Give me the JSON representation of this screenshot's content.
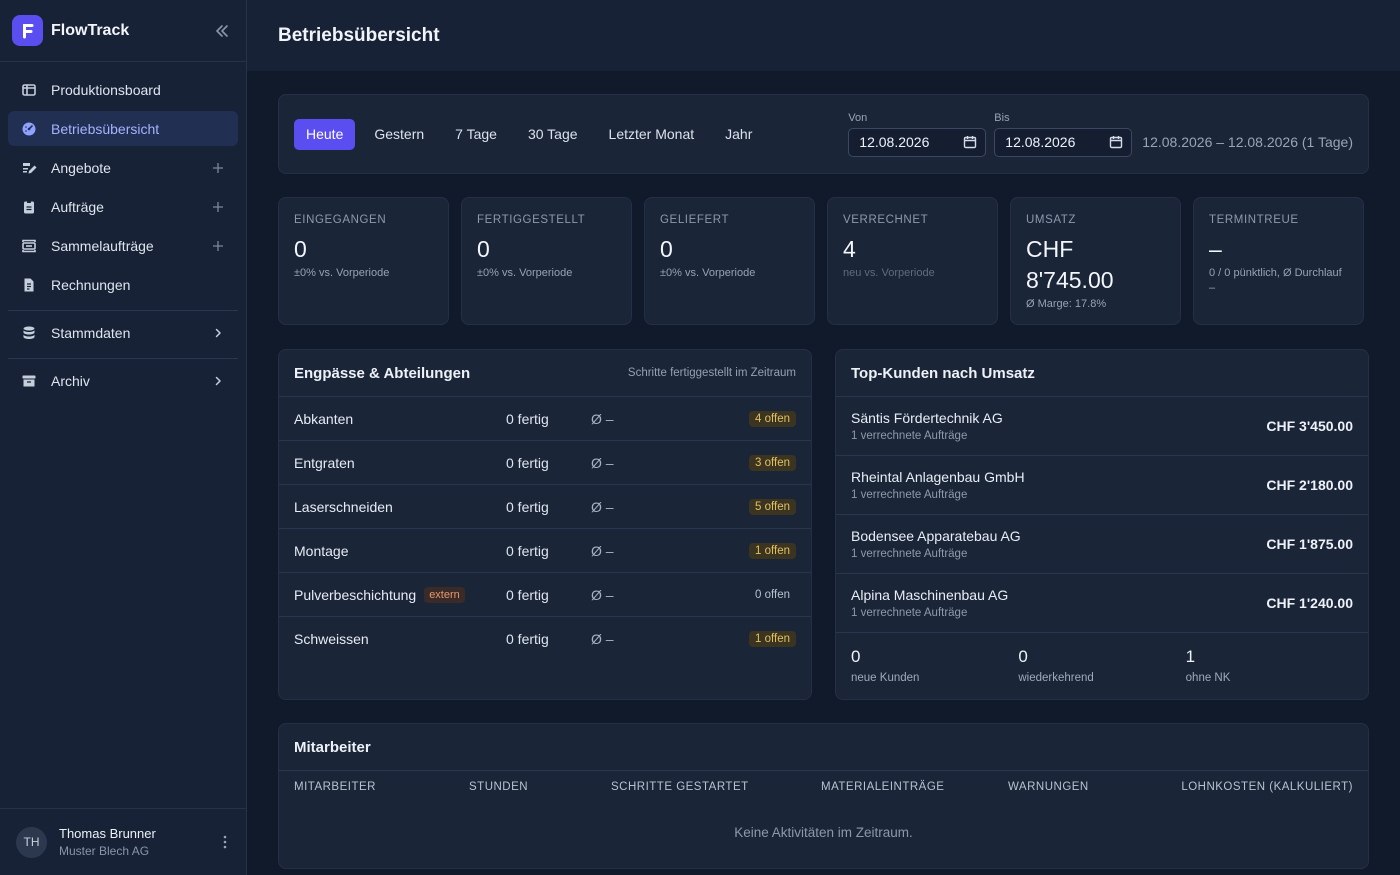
{
  "brand": {
    "name": "FlowTrack"
  },
  "sidebar": {
    "items": [
      {
        "label": "Produktionsboard",
        "icon": "board-icon"
      },
      {
        "label": "Betriebsübersicht",
        "icon": "dashboard-icon",
        "active": true
      },
      {
        "label": "Angebote",
        "icon": "edit-document-icon",
        "trail": "plus"
      },
      {
        "label": "Aufträge",
        "icon": "clipboard-icon",
        "trail": "plus"
      },
      {
        "label": "Sammelaufträge",
        "icon": "collection-icon",
        "trail": "plus"
      },
      {
        "label": "Rechnungen",
        "icon": "invoice-icon"
      },
      {
        "label": "Stammdaten",
        "icon": "database-icon",
        "trail": "chevron"
      },
      {
        "label": "Archiv",
        "icon": "archive-icon",
        "trail": "chevron"
      }
    ]
  },
  "user": {
    "initials": "TH",
    "name": "Thomas Brunner",
    "company": "Muster Blech AG"
  },
  "page": {
    "title": "Betriebsübersicht"
  },
  "filter": {
    "ranges": [
      "Heute",
      "Gestern",
      "7 Tage",
      "30 Tage",
      "Letzter Monat",
      "Jahr"
    ],
    "active_range": "Heute",
    "from_label": "Von",
    "from_value": "12.08.2026",
    "to_label": "Bis",
    "to_value": "12.08.2026",
    "summary": "12.08.2026 – 12.08.2026 (1 Tage)"
  },
  "kpis": [
    {
      "label": "EINGEGANGEN",
      "value": "0",
      "note": "±0% vs. Vorperiode"
    },
    {
      "label": "FERTIGGESTELLT",
      "value": "0",
      "note": "±0% vs. Vorperiode"
    },
    {
      "label": "GELIEFERT",
      "value": "0",
      "note": "±0% vs. Vorperiode"
    },
    {
      "label": "VERRECHNET",
      "value": "4",
      "note": "neu vs. Vorperiode"
    },
    {
      "label": "UMSATZ",
      "value": "CHF 8'745.00",
      "note": "Ø Marge: 17.8%"
    },
    {
      "label": "TERMINTREUE",
      "value": "–",
      "note": "0 / 0 pünktlich, Ø Durchlauf –"
    }
  ],
  "bottlenecks": {
    "title": "Engpässe & Abteilungen",
    "subtitle": "Schritte fertiggestellt im Zeitraum",
    "rows": [
      {
        "name": "Abkanten",
        "done": "0 fertig",
        "avg": "Ø –",
        "open": "4 offen",
        "warn": true
      },
      {
        "name": "Entgraten",
        "done": "0 fertig",
        "avg": "Ø –",
        "open": "3 offen",
        "warn": true
      },
      {
        "name": "Laserschneiden",
        "done": "0 fertig",
        "avg": "Ø –",
        "open": "5 offen",
        "warn": true
      },
      {
        "name": "Montage",
        "done": "0 fertig",
        "avg": "Ø –",
        "open": "1 offen",
        "warn": true
      },
      {
        "name": "Pulverbeschichtung",
        "badge": "extern",
        "done": "0 fertig",
        "avg": "Ø –",
        "open": "0 offen",
        "warn": false
      },
      {
        "name": "Schweissen",
        "done": "0 fertig",
        "avg": "Ø –",
        "open": "1 offen",
        "warn": true
      }
    ]
  },
  "customers": {
    "title": "Top-Kunden nach Umsatz",
    "rows": [
      {
        "name": "Säntis Fördertechnik AG",
        "sub": "1 verrechnete Aufträge",
        "amount": "CHF 3'450.00"
      },
      {
        "name": "Rheintal Anlagenbau GmbH",
        "sub": "1 verrechnete Aufträge",
        "amount": "CHF 2'180.00"
      },
      {
        "name": "Bodensee Apparatebau AG",
        "sub": "1 verrechnete Aufträge",
        "amount": "CHF 1'875.00"
      },
      {
        "name": "Alpina Maschinenbau AG",
        "sub": "1 verrechnete Aufträge",
        "amount": "CHF 1'240.00"
      }
    ],
    "stats": [
      {
        "value": "0",
        "label": "neue Kunden"
      },
      {
        "value": "0",
        "label": "wiederkehrend"
      },
      {
        "value": "1",
        "label": "ohne NK"
      }
    ]
  },
  "staff": {
    "title": "Mitarbeiter",
    "columns": [
      "MITARBEITER",
      "STUNDEN",
      "SCHRITTE GESTARTET",
      "MATERIALEINTRÄGE",
      "WARNUNGEN",
      "LOHNKOSTEN (KALKULIERT)"
    ],
    "empty": "Keine Aktivitäten im Zeitraum."
  },
  "colors": {
    "accent": "#5b4ef0",
    "background": "#111a2b",
    "card": "#1a2538",
    "warn": "#e2c061",
    "extern": "#e39a6f"
  }
}
